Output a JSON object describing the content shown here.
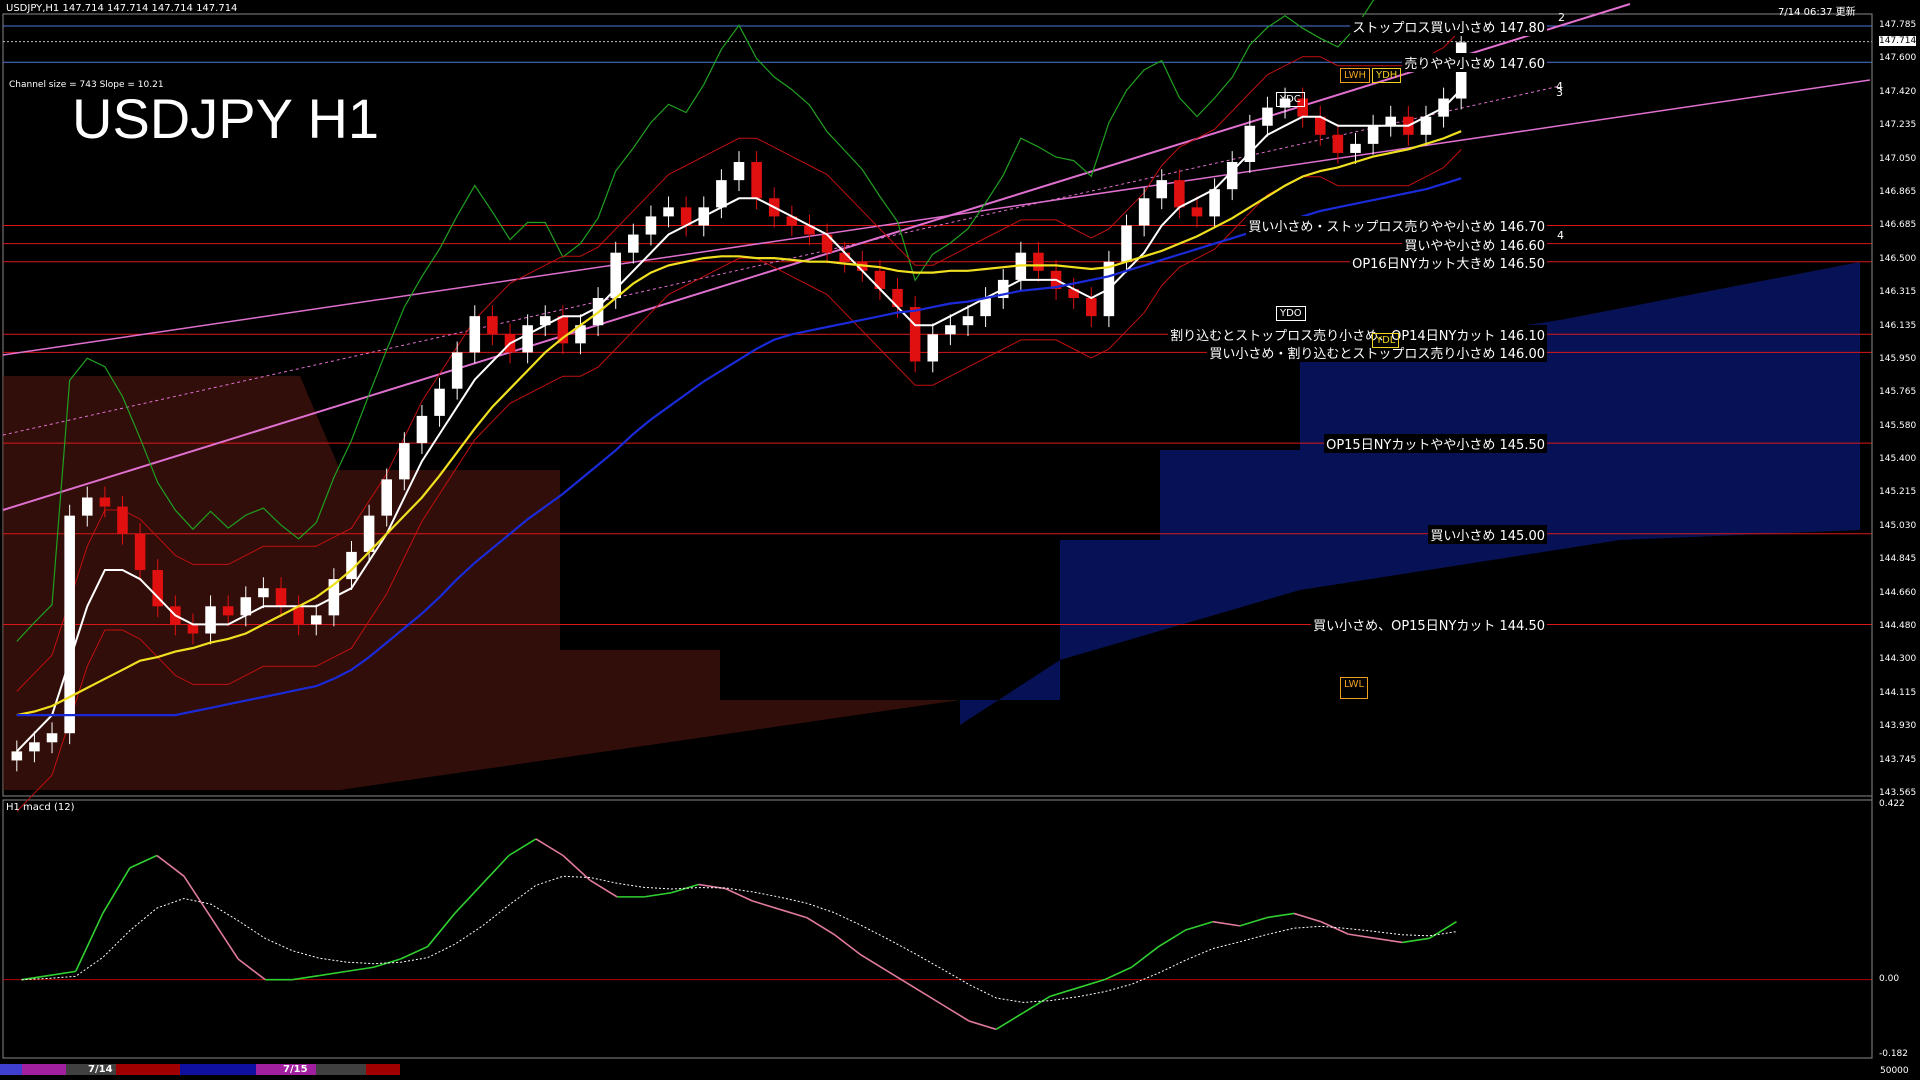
{
  "window": {
    "header_left": "USDJPY,H1  147.714 147.714 147.714 147.714",
    "header_right": "7/14 06:37 更新",
    "channel_info": "Channel size = 743 Slope = 10.21",
    "big_title": "USDJPY H1",
    "sub_window_label": "H1  macd (12)",
    "bottom_dates": [
      "7/14",
      "7/15"
    ],
    "bottom_right": "50000"
  },
  "price_axis": [
    "147.785",
    "147.600",
    "147.420",
    "147.235",
    "147.050",
    "146.865",
    "146.685",
    "146.500",
    "146.315",
    "146.135",
    "145.950",
    "145.765",
    "145.580",
    "145.400",
    "145.215",
    "145.030",
    "144.845",
    "144.660",
    "144.480",
    "144.300",
    "144.115",
    "143.930",
    "143.745",
    "143.565"
  ],
  "current_price": "147.714",
  "macd_axis": [
    "0.422",
    "0.00",
    "-0.182"
  ],
  "levels": [
    {
      "text": "ストップロス買い小さめ 147.80",
      "price": 147.8,
      "color": "#4a78d8"
    },
    {
      "text": "売りやや小さめ 147.60",
      "price": 147.6,
      "color": "#4a78d8"
    },
    {
      "text": "買い小さめ・ストップロス売りやや小さめ 146.70",
      "price": 146.7,
      "color": "#d81818"
    },
    {
      "text": "買いやや小さめ 146.60",
      "price": 146.6,
      "color": "#d81818"
    },
    {
      "text": "OP16日NYカット大きめ 146.50",
      "price": 146.5,
      "color": "#d81818"
    },
    {
      "text": "割り込むとストップロス売り小さめ、OP14日NYカット 146.10",
      "price": 146.1,
      "color": "#d81818"
    },
    {
      "text": "買い小さめ・割り込むとストップロス売り小さめ 146.00",
      "price": 146.0,
      "color": "#d81818"
    },
    {
      "text": "OP15日NYカットやや小さめ 145.50",
      "price": 145.5,
      "color": "#d81818"
    },
    {
      "text": "買い小さめ 145.00",
      "price": 145.0,
      "color": "#d81818"
    },
    {
      "text": "買い小さめ、OP15日NYカット 144.50",
      "price": 144.5,
      "color": "#d81818"
    }
  ],
  "badges": [
    {
      "text": "LWH",
      "color": "#f0a020"
    },
    {
      "text": "YDH",
      "color": "#f0d020"
    },
    {
      "text": "YDC",
      "color": "#ffffff"
    },
    {
      "text": "YDO",
      "color": "#ffffff"
    },
    {
      "text": "YDL",
      "color": "#f0d020"
    },
    {
      "text": "LWL",
      "color": "#f0a020"
    }
  ],
  "channel_tags": [
    "2",
    "4",
    "3",
    "4"
  ],
  "chart_data": {
    "type": "candlestick",
    "title": "USDJPY H1",
    "ylim": [
      143.565,
      147.8
    ],
    "macd_ylim": [
      -0.182,
      0.422
    ],
    "ohlc_close": [
      143.8,
      143.85,
      143.9,
      145.1,
      145.2,
      145.15,
      145.0,
      144.8,
      144.6,
      144.5,
      144.45,
      144.6,
      144.55,
      144.65,
      144.7,
      144.6,
      144.5,
      144.55,
      144.75,
      144.9,
      145.1,
      145.3,
      145.5,
      145.65,
      145.8,
      146.0,
      146.2,
      146.1,
      146.0,
      146.15,
      146.2,
      146.05,
      146.15,
      146.3,
      146.55,
      146.65,
      146.75,
      146.8,
      146.7,
      146.8,
      146.95,
      147.05,
      146.85,
      146.75,
      146.7,
      146.65,
      146.55,
      146.5,
      146.45,
      146.35,
      146.25,
      145.95,
      146.1,
      146.15,
      146.2,
      146.3,
      146.4,
      146.55,
      146.45,
      146.35,
      146.3,
      146.2,
      146.5,
      146.7,
      146.85,
      146.95,
      146.8,
      146.75,
      146.9,
      147.05,
      147.25,
      147.35,
      147.4,
      147.3,
      147.2,
      147.1,
      147.15,
      147.25,
      147.3,
      147.2,
      147.3,
      147.4,
      147.71
    ],
    "macd": [
      0.0,
      0.01,
      0.02,
      0.16,
      0.27,
      0.3,
      0.25,
      0.15,
      0.05,
      0.0,
      0.0,
      0.01,
      0.02,
      0.03,
      0.05,
      0.08,
      0.16,
      0.23,
      0.3,
      0.34,
      0.3,
      0.24,
      0.2,
      0.2,
      0.21,
      0.23,
      0.22,
      0.19,
      0.17,
      0.15,
      0.11,
      0.06,
      0.02,
      -0.02,
      -0.06,
      -0.1,
      -0.12,
      -0.08,
      -0.04,
      -0.02,
      0.0,
      0.03,
      0.08,
      0.12,
      0.14,
      0.13,
      0.15,
      0.16,
      0.14,
      0.11,
      0.1,
      0.09,
      0.1,
      0.14
    ],
    "ma_white": [
      143.8,
      143.9,
      144.0,
      144.3,
      144.6,
      144.8,
      144.8,
      144.75,
      144.65,
      144.55,
      144.5,
      144.5,
      144.5,
      144.55,
      144.6,
      144.6,
      144.6,
      144.6,
      144.65,
      144.7,
      144.85,
      145.0,
      145.2,
      145.4,
      145.55,
      145.7,
      145.85,
      145.95,
      146.05,
      146.1,
      146.15,
      146.2,
      146.2,
      146.25,
      146.35,
      146.45,
      146.55,
      146.65,
      146.7,
      146.75,
      146.8,
      146.85,
      146.85,
      146.8,
      146.75,
      146.7,
      146.65,
      146.55,
      146.45,
      146.35,
      146.25,
      146.15,
      146.15,
      146.2,
      146.25,
      146.3,
      146.35,
      146.4,
      146.4,
      146.4,
      146.35,
      146.3,
      146.35,
      146.45,
      146.55,
      146.7,
      146.8,
      146.85,
      146.9,
      147.0,
      147.1,
      147.2,
      147.25,
      147.3,
      147.3,
      147.25,
      147.25,
      147.25,
      147.25,
      147.25,
      147.3,
      147.35,
      147.45
    ],
    "ma_yellow": [
      144.0,
      144.02,
      144.05,
      144.1,
      144.15,
      144.2,
      144.25,
      144.3,
      144.32,
      144.35,
      144.37,
      144.4,
      144.42,
      144.45,
      144.5,
      144.55,
      144.6,
      144.65,
      144.72,
      144.8,
      144.9,
      145.0,
      145.1,
      145.2,
      145.32,
      145.45,
      145.58,
      145.7,
      145.8,
      145.9,
      146.0,
      146.08,
      146.15,
      146.22,
      146.3,
      146.38,
      146.44,
      146.48,
      146.5,
      146.52,
      146.53,
      146.53,
      146.52,
      146.52,
      146.51,
      146.5,
      146.5,
      146.49,
      146.48,
      146.47,
      146.45,
      146.44,
      146.44,
      146.45,
      146.45,
      146.46,
      146.47,
      146.48,
      146.48,
      146.48,
      146.47,
      146.46,
      146.47,
      146.5,
      146.53,
      146.56,
      146.6,
      146.64,
      146.69,
      146.74,
      146.8,
      146.86,
      146.92,
      146.97,
      147.0,
      147.02,
      147.05,
      147.08,
      147.1,
      147.12,
      147.15,
      147.18,
      147.22
    ],
    "ma_blue": [
      144.0,
      144.0,
      144.0,
      144.0,
      144.0,
      144.0,
      144.0,
      144.0,
      144.0,
      144.0,
      144.02,
      144.04,
      144.06,
      144.08,
      144.1,
      144.12,
      144.14,
      144.16,
      144.2,
      144.25,
      144.32,
      144.4,
      144.48,
      144.56,
      144.65,
      144.75,
      144.84,
      144.92,
      145.0,
      145.08,
      145.15,
      145.22,
      145.3,
      145.38,
      145.46,
      145.55,
      145.63,
      145.7,
      145.77,
      145.84,
      145.9,
      145.96,
      146.02,
      146.07,
      146.1,
      146.12,
      146.14,
      146.16,
      146.18,
      146.2,
      146.22,
      146.23,
      146.25,
      146.27,
      146.28,
      146.3,
      146.32,
      146.34,
      146.35,
      146.36,
      146.38,
      146.4,
      146.42,
      146.45,
      146.48,
      146.51,
      146.54,
      146.57,
      146.6,
      146.63,
      146.66,
      146.69,
      146.72,
      146.75,
      146.78,
      146.8,
      146.82,
      146.84,
      146.86,
      146.88,
      146.9,
      146.93,
      146.96
    ]
  },
  "colors": {
    "bull": "#ffffff",
    "bear": "#e01010",
    "ma_white": "#ffffff",
    "ma_yellow": "#f0e020",
    "ma_blue": "#1a2ad8",
    "channel": "#e070d0",
    "macd_up": "#30d030",
    "macd_down": "#e07aa0",
    "signal": "#ffffff",
    "grid_red": "#b00000"
  }
}
